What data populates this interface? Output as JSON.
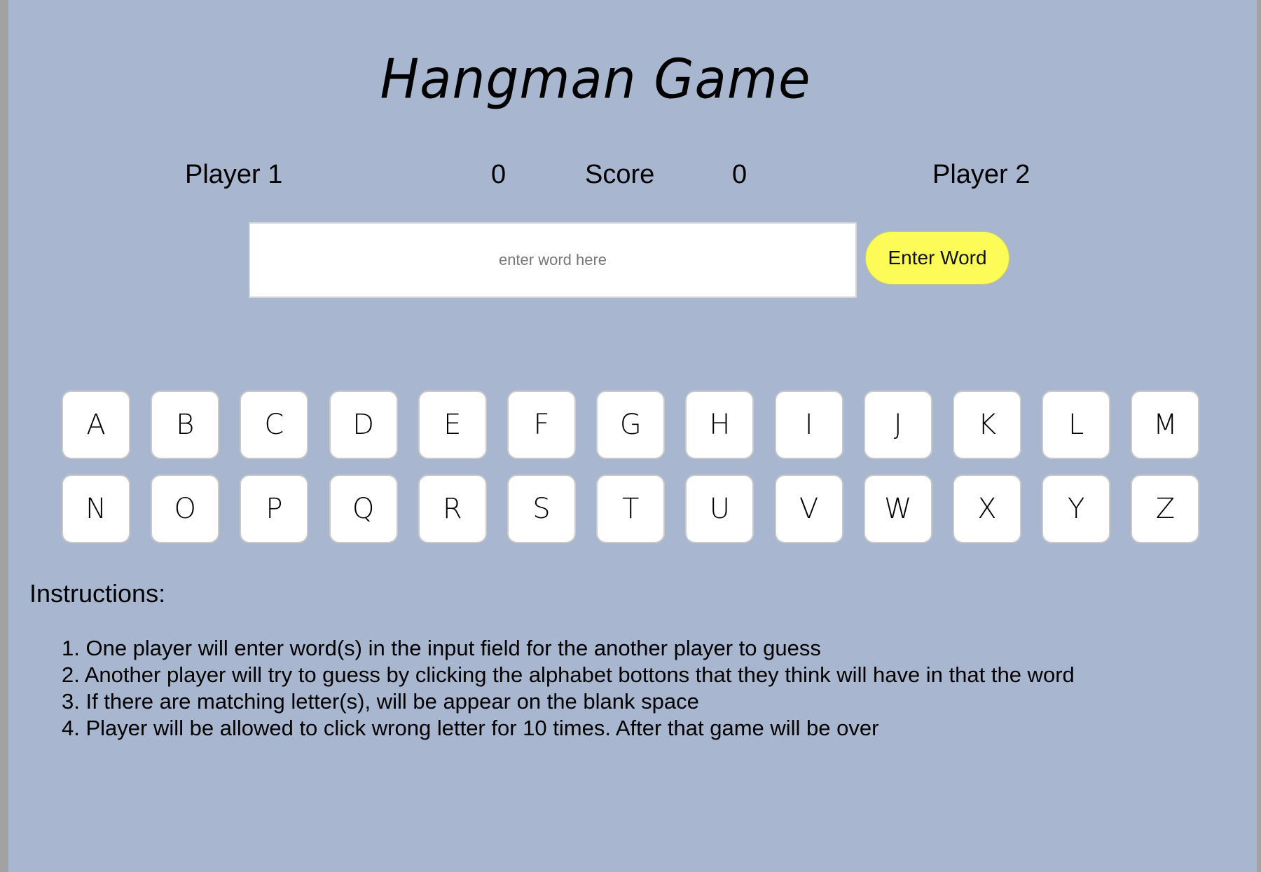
{
  "title": "Hangman Game",
  "scoreboard": {
    "player1_label": "Player 1",
    "player1_score": "0",
    "score_label": "Score",
    "player2_score": "0",
    "player2_label": "Player 2"
  },
  "word_entry": {
    "placeholder": "enter word here",
    "value": "",
    "button_label": "Enter Word"
  },
  "letters": [
    "A",
    "B",
    "C",
    "D",
    "E",
    "F",
    "G",
    "H",
    "I",
    "J",
    "K",
    "L",
    "M",
    "N",
    "O",
    "P",
    "Q",
    "R",
    "S",
    "T",
    "U",
    "V",
    "W",
    "X",
    "Y",
    "Z"
  ],
  "instructions": {
    "heading": "Instructions:",
    "items": [
      "1. One player will enter word(s) in the input field for the another player to guess",
      "2. Another player will try to guess by clicking the alphabet bottons that they think will have in that the word",
      "3. If there are matching letter(s), will be appear on the blank space",
      "4. Player will be allowed to click wrong letter for 10 times. After that game will be over"
    ]
  },
  "colors": {
    "background": "#a8b6cf",
    "button_yellow": "#fdfb57",
    "tile_white": "#ffffff"
  }
}
